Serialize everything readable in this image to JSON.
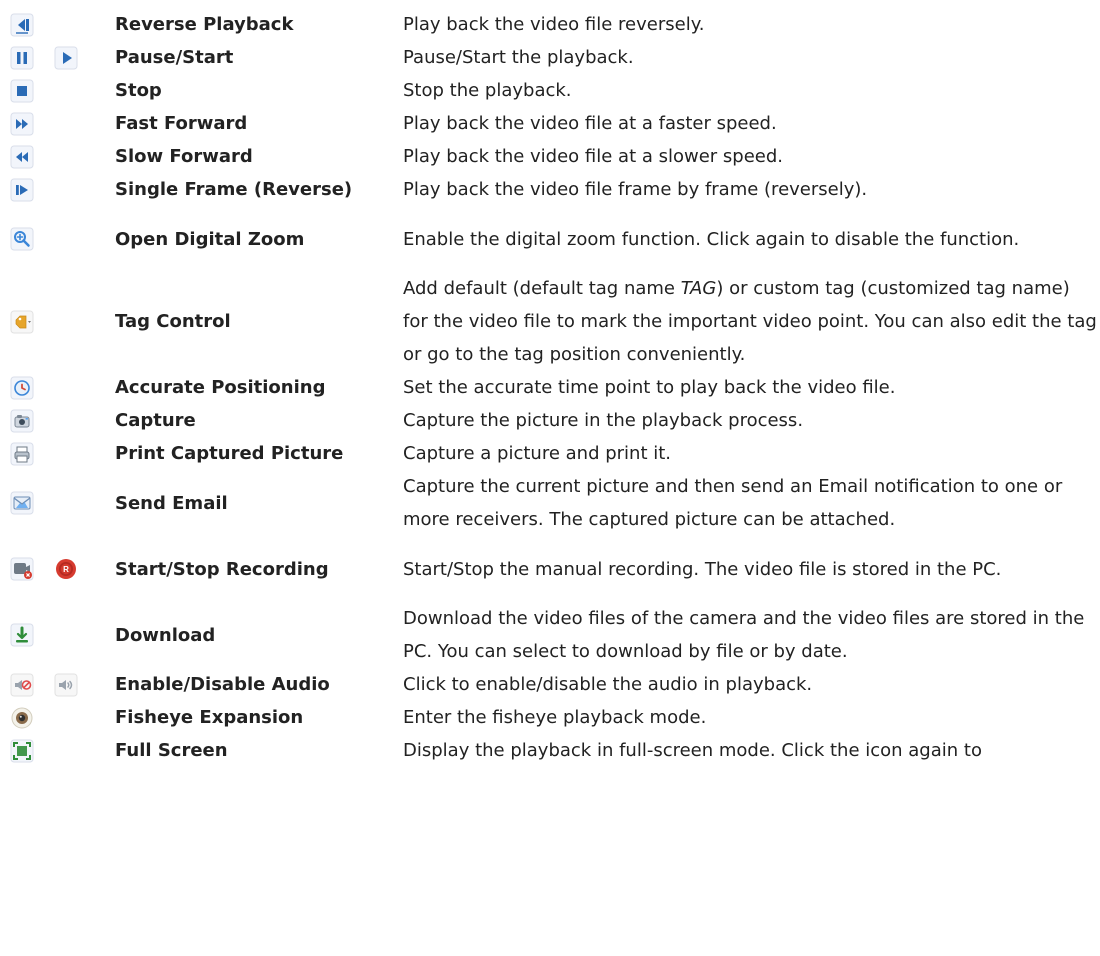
{
  "rows": [
    {
      "icons": [
        "reverse-playback-icon"
      ],
      "name": "Reverse Playback",
      "desc_parts": [
        "Play back the video file reversely."
      ]
    },
    {
      "icons": [
        "pause-icon",
        "play-icon"
      ],
      "name": "Pause/Start",
      "desc_parts": [
        "Pause/Start the playback."
      ]
    },
    {
      "icons": [
        "stop-icon"
      ],
      "name": "Stop",
      "desc_parts": [
        "Stop the playback."
      ]
    },
    {
      "icons": [
        "fast-forward-icon"
      ],
      "name": "Fast Forward",
      "desc_parts": [
        "Play back the video file at a faster speed."
      ]
    },
    {
      "icons": [
        "slow-forward-icon"
      ],
      "name": "Slow Forward",
      "desc_parts": [
        "Play back the video file at a slower speed."
      ]
    },
    {
      "icons": [
        "single-frame-reverse-icon"
      ],
      "name": "Single Frame (Reverse)",
      "desc_parts": [
        "Play back the video file frame by frame (reversely)."
      ]
    },
    {
      "icons": [
        "zoom-in-icon"
      ],
      "name": "Open Digital Zoom",
      "desc_parts": [
        "Enable the digital zoom function. Click again to disable the function."
      ]
    },
    {
      "icons": [
        "tag-icon"
      ],
      "name": "Tag Control",
      "desc_parts": [
        "Add default (default tag name ",
        "TAG",
        ") or custom tag (customized tag name) for the video file to mark the important video point. You can also edit the tag or go to the tag position conveniently."
      ]
    },
    {
      "icons": [
        "clock-icon"
      ],
      "name": "Accurate Positioning",
      "desc_parts": [
        "Set the accurate time point to play back the video file."
      ]
    },
    {
      "icons": [
        "camera-capture-icon"
      ],
      "name": "Capture",
      "desc_parts": [
        "Capture the picture in the playback process."
      ]
    },
    {
      "icons": [
        "printer-icon"
      ],
      "name": "Print Captured Picture",
      "desc_parts": [
        "Capture a picture and print it."
      ]
    },
    {
      "icons": [
        "email-icon"
      ],
      "name": "Send Email",
      "desc_parts": [
        "Capture the current picture and then send an Email notification to one or more receivers. The captured picture can be attached."
      ]
    },
    {
      "icons": [
        "record-stop-icon",
        "record-start-icon"
      ],
      "name": "Start/Stop Recording",
      "desc_parts": [
        "Start/Stop the manual recording. The video file is stored in the PC."
      ]
    },
    {
      "icons": [
        "download-icon"
      ],
      "name": "Download",
      "desc_parts": [
        "Download the video files of the camera and the video files are stored in the PC. You can select to download by file or by date."
      ]
    },
    {
      "icons": [
        "audio-disabled-icon",
        "audio-enabled-icon"
      ],
      "name": "Enable/Disable Audio",
      "desc_parts": [
        "Click to enable/disable the audio in playback."
      ]
    },
    {
      "icons": [
        "fisheye-icon"
      ],
      "name": "Fisheye Expansion",
      "desc_parts": [
        "Enter the fisheye playback mode."
      ]
    },
    {
      "icons": [
        "fullscreen-icon"
      ],
      "name": "Full Screen",
      "desc_parts": [
        "Display the playback in full-screen mode. Click the icon again to"
      ]
    }
  ]
}
